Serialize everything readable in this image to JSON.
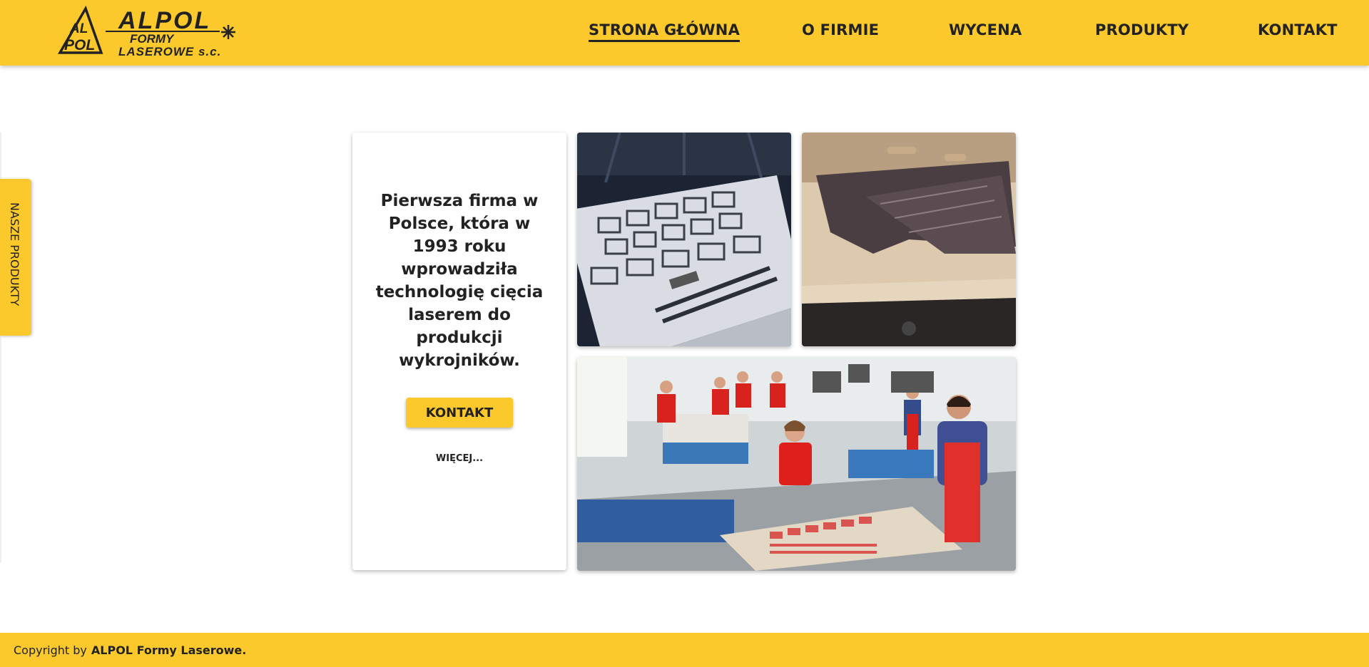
{
  "logo": {
    "line1": "ALPOL",
    "line2": "FORMY",
    "line3": "LASEROWE s.c.",
    "mark_top": "AL",
    "mark_bottom": "POL"
  },
  "nav": {
    "items": [
      {
        "label": "STRONA GŁÓWNA",
        "active": true
      },
      {
        "label": "O FIRMIE"
      },
      {
        "label": "WYCENA"
      },
      {
        "label": "PRODUKTY"
      },
      {
        "label": "KONTAKT"
      }
    ]
  },
  "side_tab": {
    "label": "NASZE PRODUKTY"
  },
  "card": {
    "headline": "Pierwsza firma w Polsce, która w 1993 roku wprowadziła technologię cięcia laserem do produkcji wykrojników.",
    "button_label": "KONTAKT",
    "more_label": "WIĘCEJ..."
  },
  "footer": {
    "copyright_prefix": "Copyright by",
    "company": "ALPOL Formy Laserowe."
  },
  "colors": {
    "accent": "#fbc92c",
    "text": "#222222",
    "background": "#ffffff"
  }
}
